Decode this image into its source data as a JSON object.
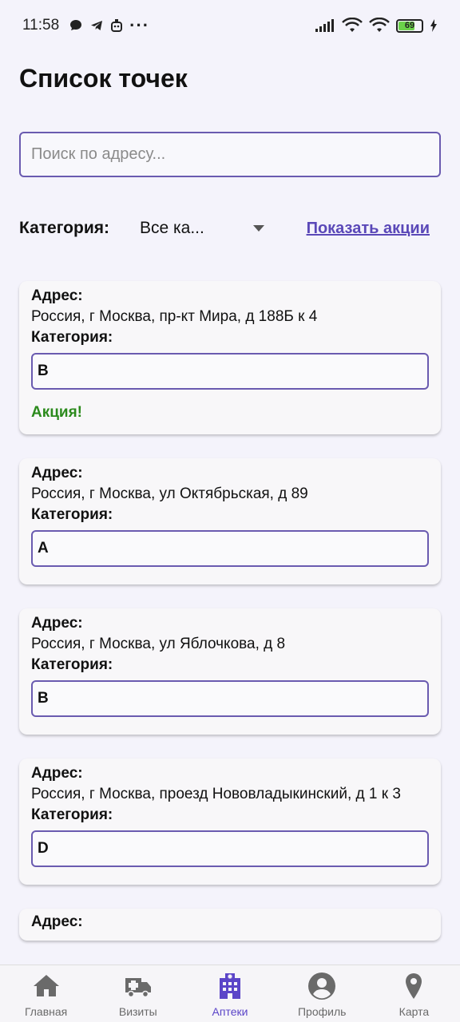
{
  "status_bar": {
    "time": "11:58",
    "dots": "···",
    "battery": "69"
  },
  "page": {
    "title": "Список точек"
  },
  "search": {
    "placeholder": "Поиск по адресу..."
  },
  "filter": {
    "label": "Категория:",
    "selected": "Все ка...",
    "promo_link": "Показать акции"
  },
  "card_labels": {
    "address": "Адрес:",
    "category": "Категория:",
    "promo": "Акция!"
  },
  "points": [
    {
      "address": "Россия, г Москва, пр-кт Мира, д 188Б к 4",
      "category": "B",
      "promo": true
    },
    {
      "address": "Россия, г Москва, ул Октябрьская, д 89",
      "category": "A",
      "promo": false
    },
    {
      "address": "Россия, г Москва, ул Яблочкова, д 8",
      "category": "B",
      "promo": false
    },
    {
      "address": "Россия, г Москва, проезд Нововладыкинский, д 1 к 3",
      "category": "D",
      "promo": false
    }
  ],
  "bottom_nav": {
    "items": [
      {
        "label": "Главная",
        "icon": "home-icon",
        "active": false
      },
      {
        "label": "Визиты",
        "icon": "ambulance-icon",
        "active": false
      },
      {
        "label": "Аптеки",
        "icon": "hospital-icon",
        "active": true
      },
      {
        "label": "Профиль",
        "icon": "profile-icon",
        "active": false
      },
      {
        "label": "Карта",
        "icon": "map-pin-icon",
        "active": false
      }
    ]
  },
  "colors": {
    "accent": "#5b45c8",
    "field_border": "#6a5bb0",
    "promo_green": "#2b8a1c",
    "background": "#f4f3fb"
  }
}
